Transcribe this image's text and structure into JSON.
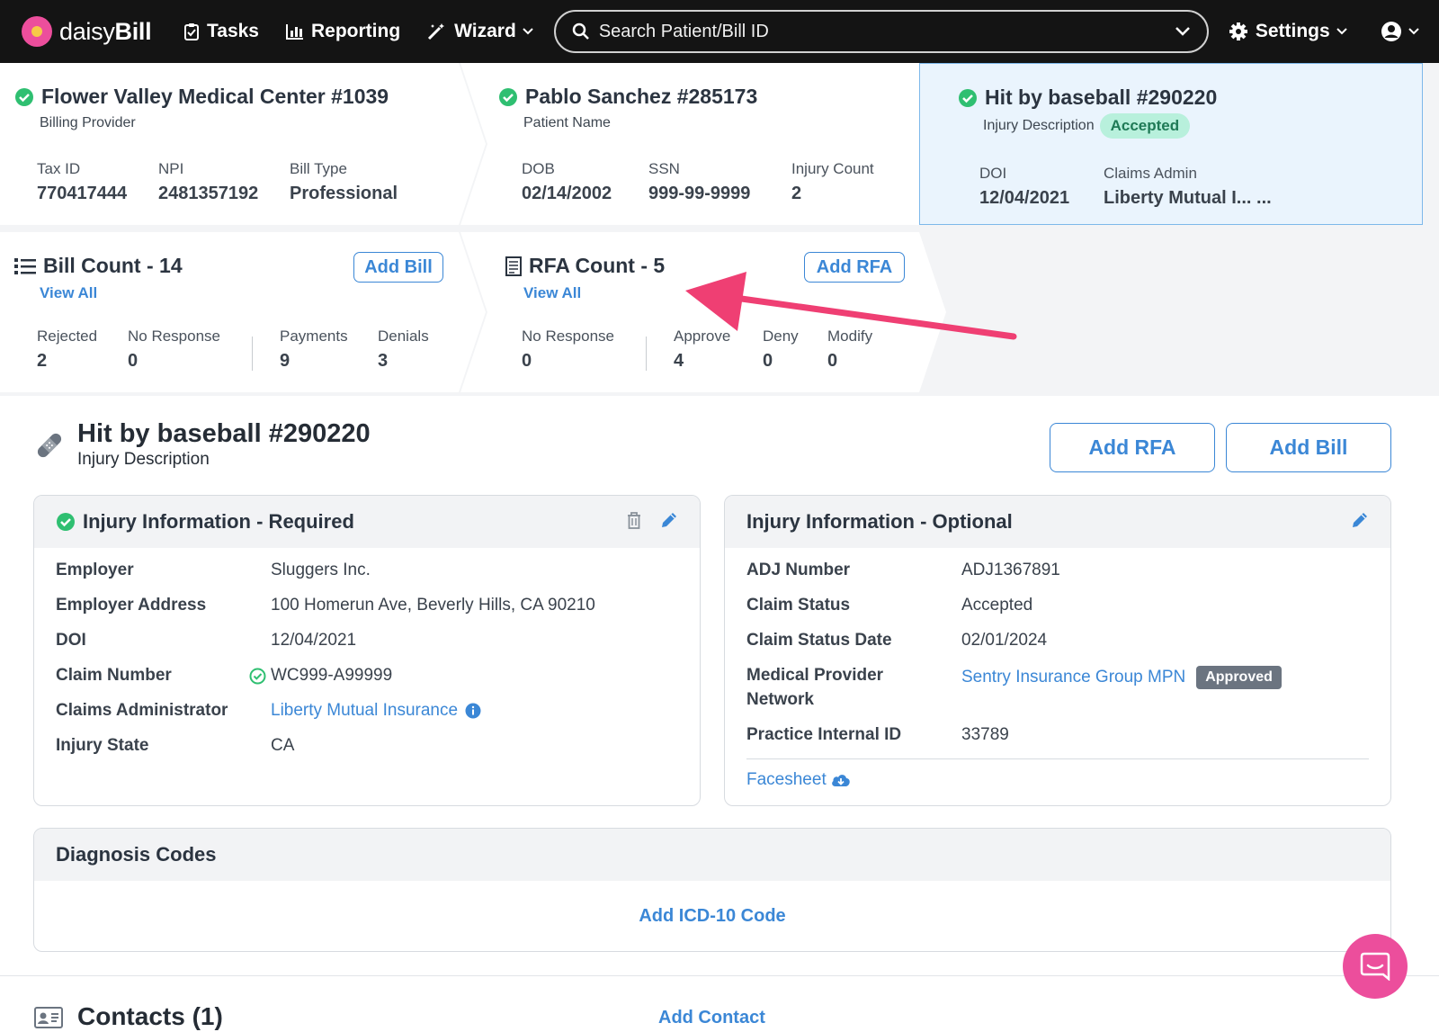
{
  "nav": {
    "logo_text_a": "daisy",
    "logo_text_b": "Bill",
    "tasks": "Tasks",
    "reporting": "Reporting",
    "wizard": "Wizard",
    "search_placeholder": "Search Patient/Bill ID",
    "settings": "Settings",
    "icons": [
      "flower-logo-icon",
      "clipboard-check-icon",
      "bar-chart-icon",
      "magic-wand-icon",
      "chevron-down-icon",
      "search-icon",
      "gear-icon",
      "user-circle-icon"
    ]
  },
  "provider_card": {
    "title": "Flower Valley Medical Center #1039",
    "subtitle": "Billing Provider",
    "fields": [
      {
        "label": "Tax ID",
        "value": "770417444"
      },
      {
        "label": "NPI",
        "value": "2481357192"
      },
      {
        "label": "Bill Type",
        "value": "Professional"
      }
    ]
  },
  "patient_card": {
    "title": "Pablo Sanchez #285173",
    "subtitle": "Patient Name",
    "fields": [
      {
        "label": "DOB",
        "value": "02/14/2002"
      },
      {
        "label": "SSN",
        "value": "999-99-9999"
      },
      {
        "label": "Injury Count",
        "value": "2"
      }
    ]
  },
  "injury_card": {
    "title": "Hit by baseball #290220",
    "subtitle": "Injury Description",
    "badge": "Accepted",
    "fields": [
      {
        "label": "DOI",
        "value": "12/04/2021"
      },
      {
        "label": "Claims Admin",
        "value": "Liberty Mutual I... ..."
      }
    ]
  },
  "bill_card": {
    "title": "Bill Count - 14",
    "view_all": "View All",
    "add_button": "Add Bill",
    "stats": [
      {
        "label": "Rejected",
        "value": "2"
      },
      {
        "label": "No Response",
        "value": "0"
      },
      {
        "label": "Payments",
        "value": "9"
      },
      {
        "label": "Denials",
        "value": "3"
      }
    ]
  },
  "rfa_card": {
    "title": "RFA Count - 5",
    "view_all": "View All",
    "add_button": "Add RFA",
    "stats": [
      {
        "label": "No Response",
        "value": "0"
      },
      {
        "label": "Approve",
        "value": "4"
      },
      {
        "label": "Deny",
        "value": "0"
      },
      {
        "label": "Modify",
        "value": "0"
      }
    ]
  },
  "injury_header": {
    "title": "Hit by baseball #290220",
    "subtitle": "Injury Description",
    "add_rfa": "Add RFA",
    "add_bill": "Add Bill"
  },
  "required_panel": {
    "title": "Injury Information - Required",
    "rows": [
      {
        "label": "Employer",
        "value": "Sluggers Inc."
      },
      {
        "label": "Employer Address",
        "value": "100 Homerun Ave, Beverly Hills, CA 90210"
      },
      {
        "label": "DOI",
        "value": "12/04/2021"
      },
      {
        "label": "Claim Number",
        "value": "WC999-A99999"
      },
      {
        "label": "Claims Administrator",
        "value": "Liberty Mutual Insurance"
      },
      {
        "label": "Injury State",
        "value": "CA"
      }
    ]
  },
  "optional_panel": {
    "title": "Injury Information - Optional",
    "rows": [
      {
        "label": "ADJ Number",
        "value": "ADJ1367891"
      },
      {
        "label": "Claim Status",
        "value": "Accepted"
      },
      {
        "label": "Claim Status Date",
        "value": "02/01/2024"
      },
      {
        "label": "Medical Provider",
        "label2": "Network",
        "value": "Sentry Insurance Group MPN",
        "badge": "Approved"
      },
      {
        "label": "Practice Internal ID",
        "value": "33789"
      }
    ],
    "facesheet": "Facesheet"
  },
  "diagnosis_panel": {
    "title": "Diagnosis Codes",
    "add_code": "Add ICD-10 Code"
  },
  "contacts": {
    "title": "Contacts (1)",
    "add_contact": "Add Contact"
  },
  "colors": {
    "accent": "#3b87d6",
    "brand_pink": "#ec4e9c",
    "success": "#2fbf71",
    "nav_bg": "#141414"
  }
}
